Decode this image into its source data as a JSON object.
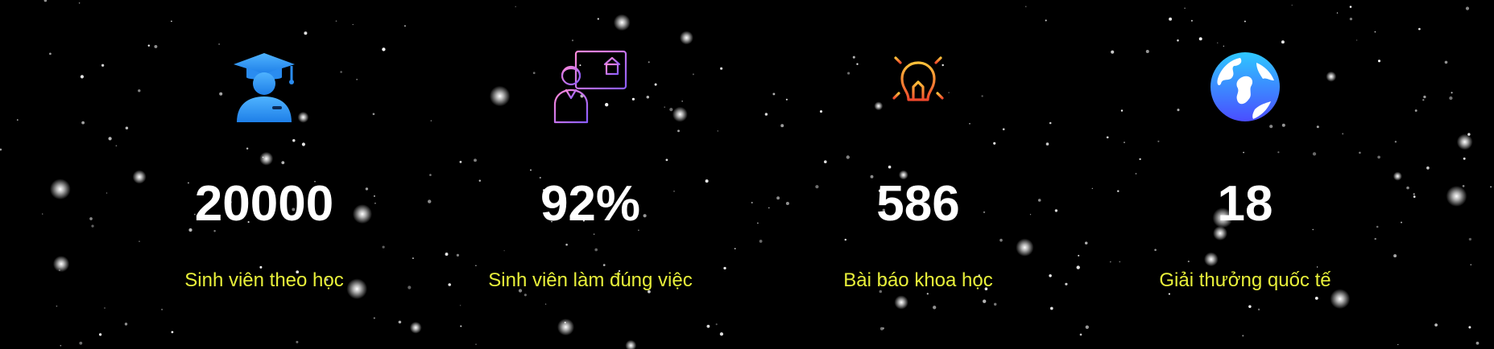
{
  "colors": {
    "background": "#000000",
    "value": "#ffffff",
    "label": "#e8f03a",
    "star": "#ffffff"
  },
  "stats": [
    {
      "icon": "graduate-student-icon",
      "value": "20000",
      "label": "Sinh viên theo học"
    },
    {
      "icon": "teacher-presentation-icon",
      "value": "92%",
      "label": "Sinh viên làm đúng việc"
    },
    {
      "icon": "lightbulb-icon",
      "value": "586",
      "label": "Bài báo khoa học"
    },
    {
      "icon": "globe-icon",
      "value": "18",
      "label": "Giải thưởng quốc tế"
    }
  ]
}
